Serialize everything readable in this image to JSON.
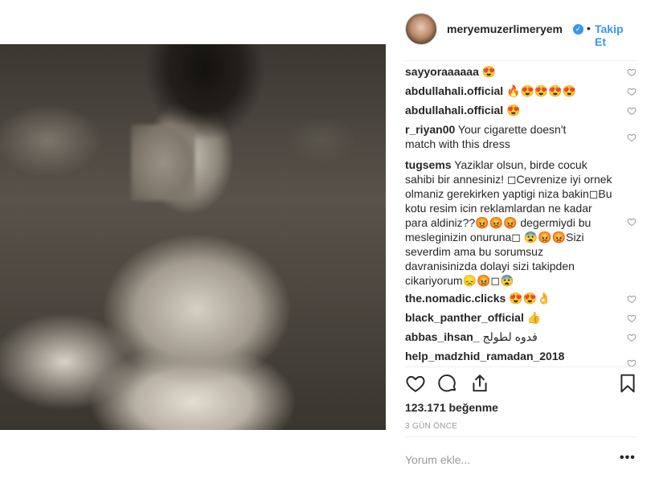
{
  "post": {
    "username": "meryemuzerlimeryem",
    "follow_label": "Takip Et",
    "dot": "•",
    "verified_glyph": "✓",
    "likes": "123.171 beğenme",
    "date": "3 GÜN ÖNCE",
    "add_comment_placeholder": "Yorum ekle...",
    "more_label": "•••"
  },
  "comments": [
    {
      "user": "sayyoraaaaaa",
      "text": " 😍"
    },
    {
      "user": "abdullahali.official",
      "text": " 🔥😍😍😍😍"
    },
    {
      "user": "abdullahali.official",
      "text": " 😍"
    },
    {
      "user": "r_riyan00",
      "text": " Your cigarette doesn't match with this dress"
    },
    {
      "user": "tugsems",
      "text": " Yaziklar olsun, birde cocuk sahibi bir annesiniz! ◻︎Cevrenize iyi ornek olmaniz gerekirken yaptigi niza bakin◻︎Bu kotu resim icin reklamlardan ne kadar para aldiniz??😡😡😡 degermiydi bu mesleginizin onuruna◻︎ 😨😡😡Sizi severdim ama bu sorumsuz davranisinizda dolayi sizi takipden cikariyorum😞😡◻︎😨"
    },
    {
      "user": "the.nomadic.clicks",
      "text": " 😍😍👌"
    },
    {
      "user": "black_panther_official",
      "text": " 👍"
    },
    {
      "user": "abbas_ihsan_",
      "text": " فدوه لطولج"
    },
    {
      "user": "help_madzhid_ramadan_2018",
      "text": ""
    }
  ],
  "colors": {
    "accent": "#3897f0",
    "text": "#262626",
    "muted": "#999999",
    "divider": "#efefef"
  },
  "icons": [
    "heart-icon",
    "comment-icon",
    "share-icon",
    "bookmark-icon",
    "verified-icon"
  ]
}
